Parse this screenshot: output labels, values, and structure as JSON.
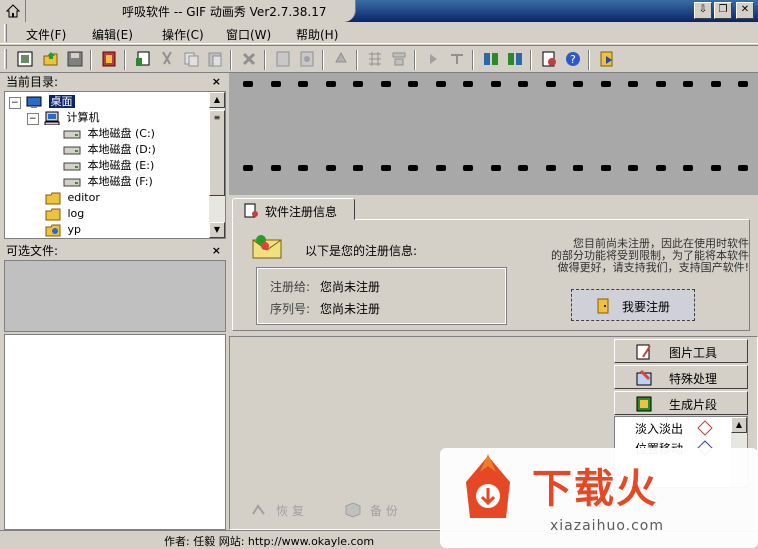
{
  "window": {
    "title": "呼吸软件 -- GIF 动画秀 Ver2.7.38.17"
  },
  "menu": [
    "文件(F)",
    "编辑(E)",
    "操作(C)",
    "窗口(W)",
    "帮助(H)"
  ],
  "toolbar_icons": [
    "new-icon",
    "open-icon",
    "save-icon",
    "film-icon",
    "copy-page-icon",
    "cut-icon",
    "copy-icon",
    "paste-icon",
    "delete-icon",
    "frame-a-icon",
    "frame-b-icon",
    "rotate-icon",
    "grid-icon",
    "stack-icon",
    "play-icon",
    "stop-icon",
    "export-a-icon",
    "export-b-icon",
    "settings-icon",
    "help-icon",
    "register-icon"
  ],
  "dir_panel": {
    "title": "当前目录:",
    "close": "×",
    "tree": [
      {
        "label": "桌面",
        "level": 0,
        "selected": true
      },
      {
        "label": "计算机",
        "level": 1
      },
      {
        "label": "本地磁盘 (C:)",
        "level": 2
      },
      {
        "label": "本地磁盘 (D:)",
        "level": 2
      },
      {
        "label": "本地磁盘 (E:)",
        "level": 2
      },
      {
        "label": "本地磁盘 (F:)",
        "level": 2
      },
      {
        "label": "editor",
        "level": 1
      },
      {
        "label": "log",
        "level": 1
      },
      {
        "label": "yp",
        "level": 1
      }
    ]
  },
  "file_panel": {
    "title": "可选文件:",
    "close": "×"
  },
  "registration": {
    "tab_label": "软件注册信息",
    "heading": "以下是您的注册信息:",
    "registered_to_label": "注册给:",
    "registered_to_value": "您尚未注册",
    "serial_label": "序列号:",
    "serial_value": "您尚未注册",
    "notice_line1": "您目前尚未注册，因此在使用时软件",
    "notice_line2": "的部分功能将受到限制，为了能将本软件",
    "notice_line3": "做得更好，请支持我们，支持国产软件!",
    "register_button": "我要注册"
  },
  "side_buttons": [
    {
      "label": "图片工具",
      "icon": "picture-tools-icon"
    },
    {
      "label": "特殊处理",
      "icon": "special-process-icon"
    },
    {
      "label": "生成片段",
      "icon": "generate-clip-icon"
    }
  ],
  "effects": [
    "淡入淡出",
    "位置移动"
  ],
  "actions": [
    "恢 复",
    "备 份"
  ],
  "status": {
    "text": "作者: 任毅  网站: http://www.okayle.com"
  },
  "watermark": {
    "main": "下载火",
    "sub": "xiazaihuo.com"
  },
  "colors": {
    "title_bar": "#0a246a",
    "filmstrip": "#a8a8a8",
    "watermark": "#e8401c"
  }
}
